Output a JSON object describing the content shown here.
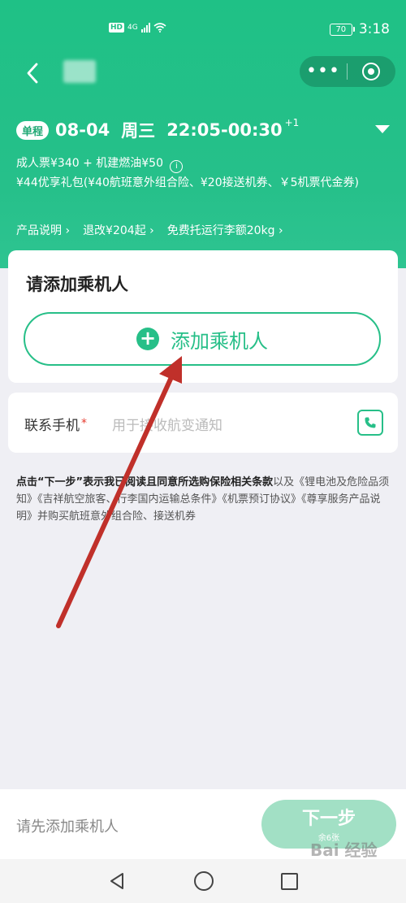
{
  "status_bar": {
    "hd": "HD",
    "network": "4G",
    "battery": "70",
    "time": "3:18"
  },
  "flight": {
    "trip_type": "单程",
    "date": "08-04",
    "weekday": "周三",
    "time": "22:05-00:30",
    "next_day": "+1",
    "price_line": "成人票¥340 + 机建燃油¥50",
    "info_icon": "i",
    "package_line": "¥44优享礼包(¥40航班意外组合险、¥20接送机券、￥5机票代金券)",
    "links": [
      "产品说明 ›",
      "退改¥204起 ›",
      "免费托运行李额20kg ›"
    ]
  },
  "passenger": {
    "title": "请添加乘机人",
    "add_button": "添加乘机人",
    "add_icon": "+"
  },
  "contact": {
    "label": "联系手机",
    "required": "*",
    "placeholder": "用于接收航变通知"
  },
  "terms": {
    "bold": "点击“下一步”表示我已阅读且同意所选购保险相关条款",
    "rest": "以及《锂电池及危险品须知》《吉祥航空旅客、行李国内运输总条件》《机票预订协议》《尊享服务产品说明》并购买航班意外组合险、接送机券"
  },
  "bottom": {
    "hint": "请先添加乘机人",
    "next_label": "下一步",
    "next_sub": "余6张"
  },
  "watermark": "Bai 经验",
  "colors": {
    "brand_green": "#27bf88",
    "header_green": "#1fc186",
    "next_disabled": "#a2e0c5",
    "annotation_arrow": "#c0302a"
  }
}
